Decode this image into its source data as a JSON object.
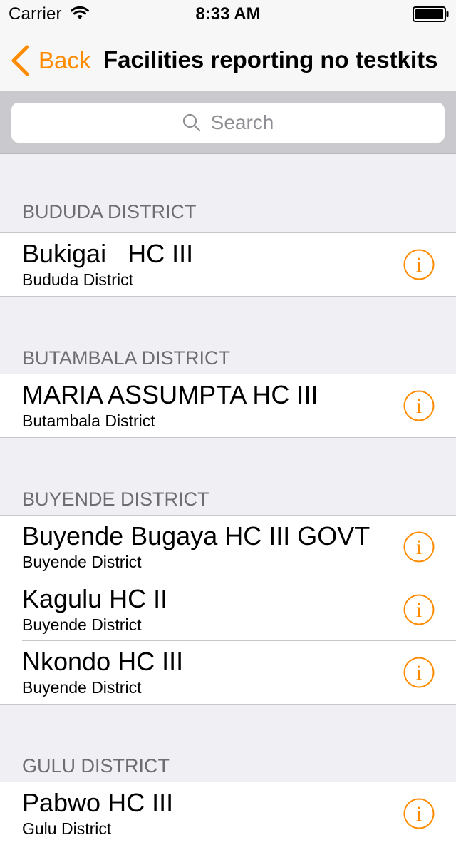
{
  "status_bar": {
    "carrier": "Carrier",
    "time": "8:33 AM"
  },
  "nav": {
    "back_label": "Back",
    "title": "Facilities reporting no testkits"
  },
  "search": {
    "placeholder": "Search"
  },
  "colors": {
    "accent": "#ff8c00",
    "section_header_text": "#6d6d72",
    "background": "#efeff4"
  },
  "sections": [
    {
      "header": "BUDUDA DISTRICT",
      "rows": [
        {
          "title": "Bukigai   HC III",
          "subtitle": "Bududa District"
        }
      ]
    },
    {
      "header": "BUTAMBALA DISTRICT",
      "rows": [
        {
          "title": "MARIA ASSUMPTA HC III",
          "subtitle": "Butambala District"
        }
      ]
    },
    {
      "header": "BUYENDE DISTRICT",
      "rows": [
        {
          "title": "Buyende Bugaya HC III GOVT",
          "subtitle": "Buyende District"
        },
        {
          "title": "Kagulu HC II",
          "subtitle": "Buyende District"
        },
        {
          "title": "Nkondo HC III",
          "subtitle": "Buyende District"
        }
      ]
    },
    {
      "header": "GULU DISTRICT",
      "rows": [
        {
          "title": "Pabwo HC III",
          "subtitle": "Gulu District"
        }
      ]
    }
  ]
}
